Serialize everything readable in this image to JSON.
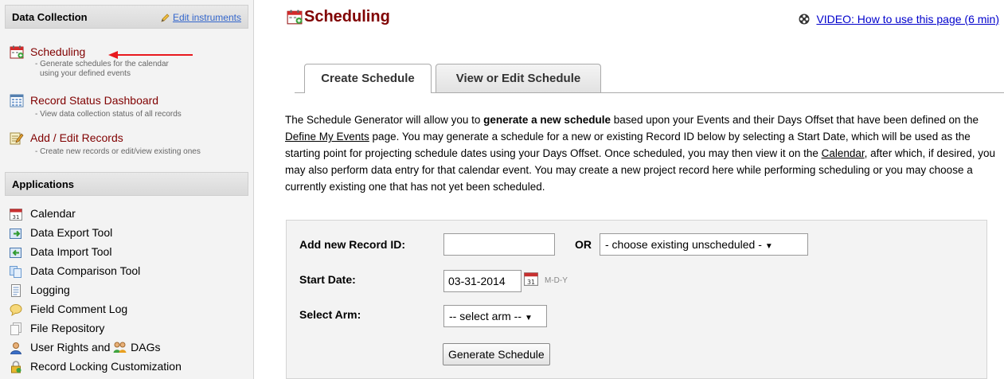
{
  "sidebar": {
    "data_collection": {
      "title": "Data Collection",
      "edit_link": "Edit instruments",
      "items": [
        {
          "label": "Scheduling",
          "desc1": "- Generate schedules for the calendar",
          "desc2": "using your defined events",
          "icon": "scheduling-icon"
        },
        {
          "label": "Record Status Dashboard",
          "desc1": "- View data collection status of all records",
          "icon": "dashboard-icon"
        },
        {
          "label": "Add / Edit Records",
          "desc1": "- Create new records or edit/view existing ones",
          "icon": "edit-records-icon"
        }
      ]
    },
    "applications": {
      "title": "Applications",
      "items": [
        {
          "label": "Calendar",
          "icon": "calendar-icon"
        },
        {
          "label": "Data Export Tool",
          "icon": "export-icon"
        },
        {
          "label": "Data Import Tool",
          "icon": "import-icon"
        },
        {
          "label": "Data Comparison Tool",
          "icon": "compare-icon"
        },
        {
          "label": "Logging",
          "icon": "log-icon"
        },
        {
          "label": "Field Comment Log",
          "icon": "comment-icon"
        },
        {
          "label": "File Repository",
          "icon": "file-icon"
        },
        {
          "label": "User Rights",
          "and": "and",
          "label2": "DAGs",
          "icon": "user-icon"
        },
        {
          "label": "Record Locking Customization",
          "icon": "lock-icon"
        }
      ]
    }
  },
  "main": {
    "title": "Scheduling",
    "video_link": "VIDEO: How to use this page (6 min)",
    "tabs": [
      {
        "label": "Create Schedule",
        "active": true
      },
      {
        "label": "View or Edit Schedule",
        "active": false
      }
    ],
    "intro": {
      "p1": "The Schedule Generator will allow you to ",
      "bold": "generate a new schedule",
      "p2": " based upon your Events and their Days Offset that have been defined on the ",
      "link1": "Define My Events",
      "p3": " page. You may generate a schedule for a new or existing Record ID below by selecting a Start Date, which will be used as the starting point for projecting schedule dates using your Days Offset. Once scheduled, you may then view it on the ",
      "link2": "Calendar",
      "p4": ", after which, if desired, you may also perform data entry for that calendar event. You may create a new project record here while performing scheduling or you may choose a currently existing one that has not yet been scheduled."
    },
    "form": {
      "record_label": "Add new Record ID:",
      "record_value": "",
      "or_label": "OR",
      "existing_select": "- choose existing unscheduled -",
      "start_label": "Start Date:",
      "start_value": "03-31-2014",
      "date_format": "M-D-Y",
      "arm_label": "Select Arm:",
      "arm_select": "-- select arm --",
      "button": "Generate Schedule"
    }
  },
  "colors": {
    "title_red": "#800000",
    "link_blue": "#0000cc",
    "panel_bg": "#f3f3f3",
    "annotation_arrow": "#e8191e"
  }
}
